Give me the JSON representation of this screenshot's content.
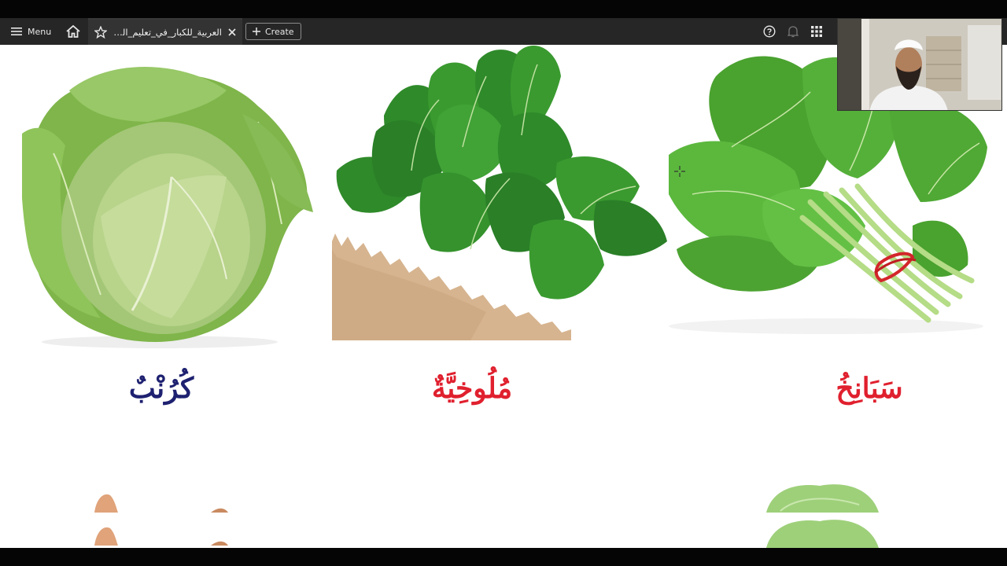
{
  "toolbar": {
    "menu_label": "Menu",
    "tab_title": "العربية_للكبار_في_تعليم_اللغ..",
    "create_label": "Create"
  },
  "slide": {
    "words": {
      "cabbage": "كُرُنْبٌ",
      "molokhia": "مُلُوخِيَّةٌ",
      "spinach": "سَبَانِخُ"
    }
  },
  "colors": {
    "toolbar_bg": "#262626",
    "cabbage_word": "#1e2170",
    "molokhia_word": "#e0202e",
    "spinach_word": "#e0202e"
  },
  "icons": [
    "hamburger-icon",
    "home-icon",
    "star-icon",
    "close-icon",
    "plus-icon",
    "help-icon",
    "bell-icon",
    "apps-grid-icon"
  ]
}
